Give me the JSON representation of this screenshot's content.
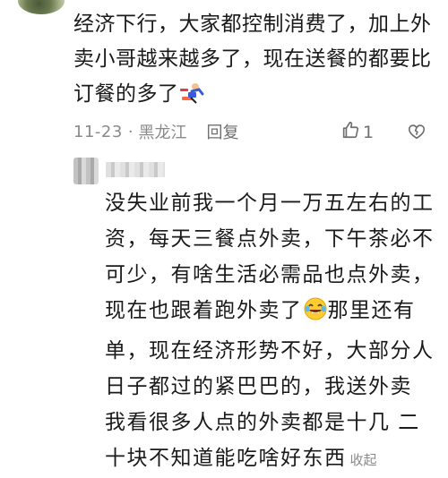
{
  "comment": {
    "text": "经济下行，大家都控制消费了，加上外卖小哥越来越多了，现在送餐的都要比订餐的多了",
    "time": "11-23",
    "dot": "·",
    "location": "黑龙江",
    "reply_label": "回复",
    "like_count": "1"
  },
  "reply": {
    "text_part1": "没失业前我一个月一万五左右的工资，每天三餐点外卖，下午茶必不可少，有啥生活必需品也点外卖，现在也跟着跑外卖了",
    "text_part2": "那里还有单，现在经济形势不好，大部分人日子都过的紧巴巴的，我送外卖 我看很多人点的外卖都是十几 二十块不知道能吃啥好东西",
    "collapse_label": "收起"
  },
  "icons": {
    "like": "like-icon",
    "dislike": "dislike-icon",
    "sticker_running": "running-man-emoji",
    "sticker_laugh": "tears-of-joy-emoji"
  }
}
